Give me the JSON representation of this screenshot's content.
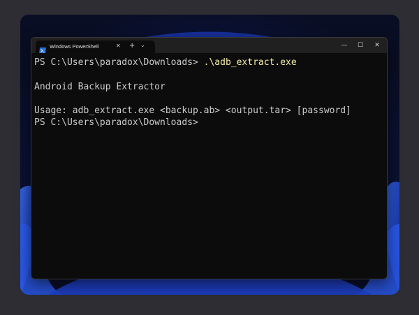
{
  "window": {
    "tab_title": "Windows PowerShell",
    "tab_close_glyph": "✕",
    "new_tab_glyph": "+",
    "dropdown_glyph": "⌄",
    "minimize_glyph": "—",
    "maximize_glyph": "☐",
    "close_glyph": "✕"
  },
  "terminal": {
    "line1_prompt": "PS C:\\Users\\paradox\\Downloads> ",
    "line1_command": ".\\adb_extract.exe",
    "line2": "Android Backup Extractor",
    "line3": "Usage: adb_extract.exe <backup.ab> <output.tar> [password]",
    "line4_prompt": "PS C:\\Users\\paradox\\Downloads>"
  },
  "colors": {
    "terminal_bg": "#0c0c0c",
    "terminal_text": "#cccccc",
    "command_text": "#f9f1a5",
    "titlebar_bg": "#202020",
    "wallpaper_accent": "#1f44c8"
  },
  "icons": {
    "tab_icon": "powershell-icon"
  }
}
